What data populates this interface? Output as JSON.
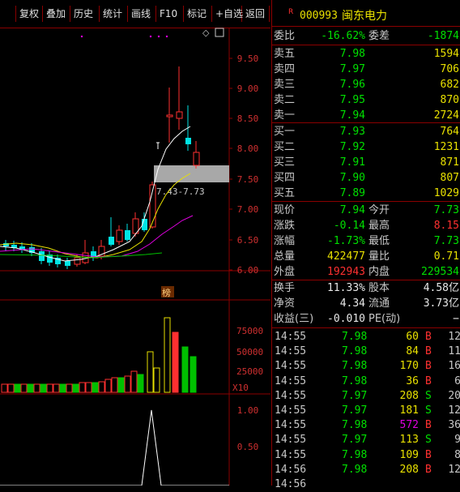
{
  "toolbar": {
    "buttons": [
      "复权",
      "叠加",
      "历史",
      "统计",
      "画线",
      "F10",
      "标记",
      "+自选",
      "返回"
    ]
  },
  "chart": {
    "price_axis": [
      "9.50",
      "9.00",
      "8.50",
      "8.00",
      "7.50",
      "7.00",
      "6.50",
      "6.00"
    ],
    "range_label": "7.43-7.73",
    "vol_axis": [
      "75000",
      "50000",
      "25000"
    ],
    "vol_unit": "X10",
    "bang_label": "榜",
    "ind_axis": [
      "1.00",
      "0.50"
    ]
  },
  "colors": {
    "up": "#ff3030",
    "down": "#00e5e5",
    "ma1": "#ffffff",
    "ma2": "#e8e000",
    "ma3": "#e000e0",
    "ma4": "#00c000",
    "grid": "#8b0000"
  },
  "stock": {
    "marker": "R",
    "code": "000993",
    "name": "闽东电力"
  },
  "quote": {
    "weibi_label": "委比",
    "weibi": "-16.62%",
    "weicha_label": "委差",
    "weicha": "-1874",
    "sell": [
      {
        "label": "卖五",
        "price": "7.98",
        "vol": "1594"
      },
      {
        "label": "卖四",
        "price": "7.97",
        "vol": "706"
      },
      {
        "label": "卖三",
        "price": "7.96",
        "vol": "682"
      },
      {
        "label": "卖二",
        "price": "7.95",
        "vol": "870"
      },
      {
        "label": "卖一",
        "price": "7.94",
        "vol": "2724"
      }
    ],
    "buy": [
      {
        "label": "买一",
        "price": "7.93",
        "vol": "764"
      },
      {
        "label": "买二",
        "price": "7.92",
        "vol": "1231"
      },
      {
        "label": "买三",
        "price": "7.91",
        "vol": "871"
      },
      {
        "label": "买四",
        "price": "7.90",
        "vol": "807"
      },
      {
        "label": "买五",
        "price": "7.89",
        "vol": "1029"
      }
    ],
    "stats": [
      {
        "l1": "现价",
        "v1": "7.94",
        "c1": "green",
        "l2": "今开",
        "v2": "7.73",
        "c2": "green"
      },
      {
        "l1": "涨跌",
        "v1": "-0.14",
        "c1": "green",
        "l2": "最高",
        "v2": "8.15",
        "c2": "red"
      },
      {
        "l1": "涨幅",
        "v1": "-1.73%",
        "c1": "green",
        "l2": "最低",
        "v2": "7.73",
        "c2": "green"
      },
      {
        "l1": "总量",
        "v1": "422477",
        "c1": "yellow",
        "l2": "量比",
        "v2": "0.71",
        "c2": "yellow"
      },
      {
        "l1": "外盘",
        "v1": "192943",
        "c1": "red",
        "l2": "内盘",
        "v2": "229534",
        "c2": "green"
      }
    ],
    "stats2": [
      {
        "l1": "换手",
        "v1": "11.33%",
        "l2": "股本",
        "v2": "4.58亿"
      },
      {
        "l1": "净资",
        "v1": "4.34",
        "l2": "流通",
        "v2": "3.73亿"
      },
      {
        "l1": "收益(三)",
        "v1": "-0.010",
        "l2": "PE(动)",
        "v2": "−"
      }
    ]
  },
  "ticks": [
    {
      "time": "14:55",
      "price": "7.98",
      "vol": "60",
      "vc": "yellow",
      "bs": "B",
      "bc": "red",
      "n": "12"
    },
    {
      "time": "14:55",
      "price": "7.98",
      "vol": "84",
      "vc": "yellow",
      "bs": "B",
      "bc": "red",
      "n": "11"
    },
    {
      "time": "14:55",
      "price": "7.98",
      "vol": "170",
      "vc": "yellow",
      "bs": "B",
      "bc": "red",
      "n": "16"
    },
    {
      "time": "14:55",
      "price": "7.98",
      "vol": "36",
      "vc": "yellow",
      "bs": "B",
      "bc": "red",
      "n": "6"
    },
    {
      "time": "14:55",
      "price": "7.97",
      "vol": "208",
      "vc": "yellow",
      "bs": "S",
      "bc": "green",
      "n": "20"
    },
    {
      "time": "14:55",
      "price": "7.97",
      "vol": "181",
      "vc": "yellow",
      "bs": "S",
      "bc": "green",
      "n": "12"
    },
    {
      "time": "14:55",
      "price": "7.98",
      "vol": "572",
      "vc": "magenta",
      "bs": "B",
      "bc": "red",
      "n": "36"
    },
    {
      "time": "14:55",
      "price": "7.97",
      "vol": "113",
      "vc": "yellow",
      "bs": "S",
      "bc": "green",
      "n": "9"
    },
    {
      "time": "14:55",
      "price": "7.98",
      "vol": "109",
      "vc": "yellow",
      "bs": "B",
      "bc": "red",
      "n": "8"
    },
    {
      "time": "14:56",
      "price": "7.98",
      "vol": "208",
      "vc": "yellow",
      "bs": "B",
      "bc": "red",
      "n": "12"
    },
    {
      "time": "14:56",
      "price": "",
      "vol": "",
      "vc": "yellow",
      "bs": "",
      "bc": "red",
      "n": ""
    }
  ]
}
